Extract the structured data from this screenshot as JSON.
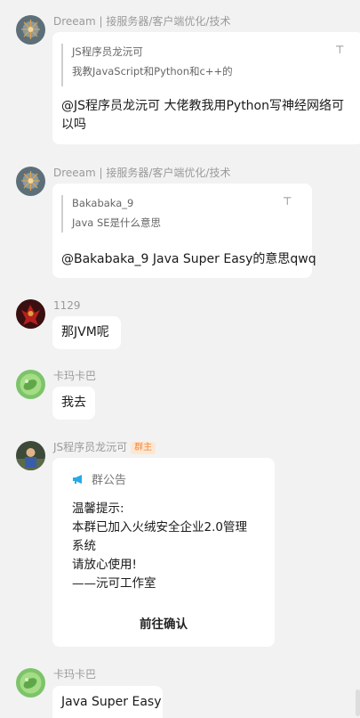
{
  "messages": [
    {
      "sender": "Dreeam | 接服务器/客户端优化/技术",
      "quote_author": "JS程序员龙沅可",
      "quote_text": "我教JavaScript和Python和c++的",
      "quote_icon": "pin-icon",
      "text_line1": "@JS程序员龙沅可 大佬教我用Python写神经网络可",
      "text_line2": "以吗"
    },
    {
      "sender": "Dreeam | 接服务器/客户端优化/技术",
      "quote_author": "Bakabaka_9",
      "quote_text": "Java SE是什么意思",
      "quote_icon": "pin-icon",
      "text": "@Bakabaka_9 Java Super Easy的意思qwq"
    },
    {
      "sender": "1129",
      "text": "那JVM呢"
    },
    {
      "sender": "卡玛卡巴",
      "text": "我去"
    },
    {
      "sender": "JS程序员龙沅可",
      "badge": "群主",
      "notice": {
        "title": "群公告",
        "icon": "megaphone-icon",
        "lines": [
          "温馨提示:",
          "本群已加入火绒安全企业2.0管理",
          "系统",
          "请放心使用!",
          "——沅可工作室"
        ],
        "action": "前往确认"
      }
    },
    {
      "sender": "卡玛卡巴",
      "text": "Java Super Easy"
    }
  ],
  "colors": {
    "background": "#f2f2f2",
    "bubble": "#ffffff",
    "badge_text": "#f08a3c",
    "badge_bg": "#fde7d3",
    "notice_icon": "#29a9e6"
  }
}
